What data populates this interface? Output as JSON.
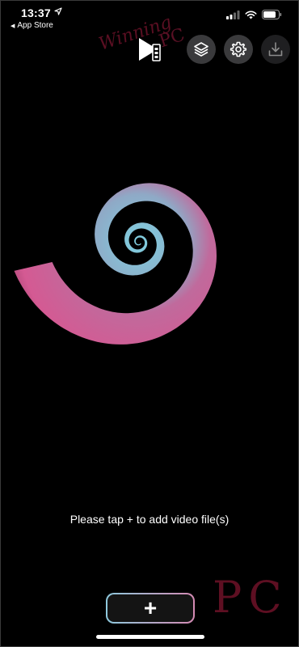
{
  "status_bar": {
    "time": "13:37",
    "back_label": "App Store"
  },
  "toolbar": {
    "buttons": [
      {
        "icon": "play-video-icon"
      },
      {
        "icon": "layers-icon"
      },
      {
        "icon": "gear-icon"
      },
      {
        "icon": "download-icon"
      }
    ]
  },
  "main": {
    "empty_hint": "Please tap + to add video file(s)"
  },
  "add_button": {
    "label": "+"
  },
  "watermark": {
    "small_text": "Winning",
    "small_pc": "PC",
    "big_text": "PC"
  },
  "colors": {
    "spiral_outer": "#c0508a",
    "spiral_inner": "#8fb8cc",
    "background": "#000000",
    "button_gradient_start": "#8ec9dd",
    "button_gradient_end": "#d48ab3"
  }
}
